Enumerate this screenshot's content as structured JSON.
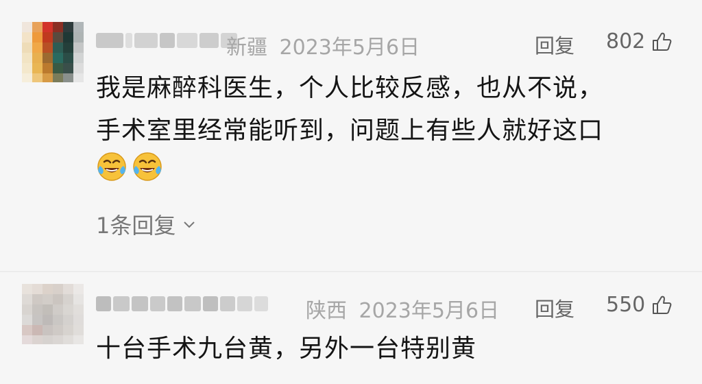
{
  "comments": [
    {
      "location": "新疆",
      "date": "2023年5月6日",
      "reply_label": "回复",
      "likes": "802",
      "lines": [
        "我是麻醉科医生，个人比较反感，也从不说，",
        "手术室里经常能听到，问题上有些人就好这口"
      ],
      "emojis": [
        "face-with-tears-of-joy",
        "face-with-tears-of-joy"
      ],
      "replies_toggle": "1条回复"
    },
    {
      "location": "陕西",
      "date": "2023年5月6日",
      "reply_label": "回复",
      "likes": "550",
      "lines": [
        "十台手术九台黄，另外一台特别黄"
      ]
    }
  ],
  "colors": {
    "background": "#f6f6f6",
    "meta_text": "#a6a6a6",
    "action_text": "#666666",
    "body_text": "#141414"
  },
  "icons": {
    "like": "thumbs-up-outline-icon",
    "expand": "chevron-down-icon",
    "emoji": "face-with-tears-of-joy-emoji"
  }
}
